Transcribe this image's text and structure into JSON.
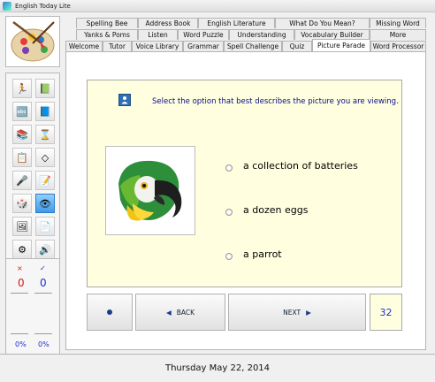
{
  "window": {
    "title": "English Today Lite"
  },
  "tabs": {
    "row1": [
      "Spelling Bee",
      "Address Book",
      "English Literature",
      "What Do You Mean?",
      "Missing Word"
    ],
    "row2": [
      "Yanks & Poms",
      "Listen",
      "Word Puzzle",
      "Understanding",
      "Vocabulary Builder",
      "More"
    ],
    "row3": [
      "Welcome",
      "Tutor",
      "Voice Library",
      "Grammar",
      "Spell Challenge",
      "Quiz",
      "Picture Parade",
      "Word Processor"
    ],
    "selected": "Picture Parade"
  },
  "question": {
    "prompt": "Select the option that best describes the picture you are viewing.",
    "picture_icon": "parrot-picture",
    "options": [
      "a collection of batteries",
      "a dozen eggs",
      "a parrot"
    ]
  },
  "nav": {
    "back_label": "BACK",
    "next_label": "NEXT",
    "counter": "32"
  },
  "score": {
    "wrong_mark": "×",
    "right_mark": "✓",
    "wrong_count": "0",
    "right_count": "0",
    "wrong_pct": "0%",
    "right_pct": "0%",
    "small_label": "○+"
  },
  "status": {
    "date": "Thursday  May  22,  2014"
  },
  "colors": {
    "panel_bg": "#ffffe0",
    "accent_blue": "#1c2fd4",
    "active_tool": "#3f9ae8"
  },
  "icons": [
    "teacher-icon",
    "vocabulary-icon",
    "spelling-icon",
    "book-icon",
    "study-icon",
    "hourglass-icon",
    "lesson-icon",
    "eraser-icon",
    "microphone-icon",
    "notes-icon",
    "game-icon",
    "eye-icon",
    "image-icon",
    "document-icon",
    "settings-icon",
    "audio-icon"
  ]
}
